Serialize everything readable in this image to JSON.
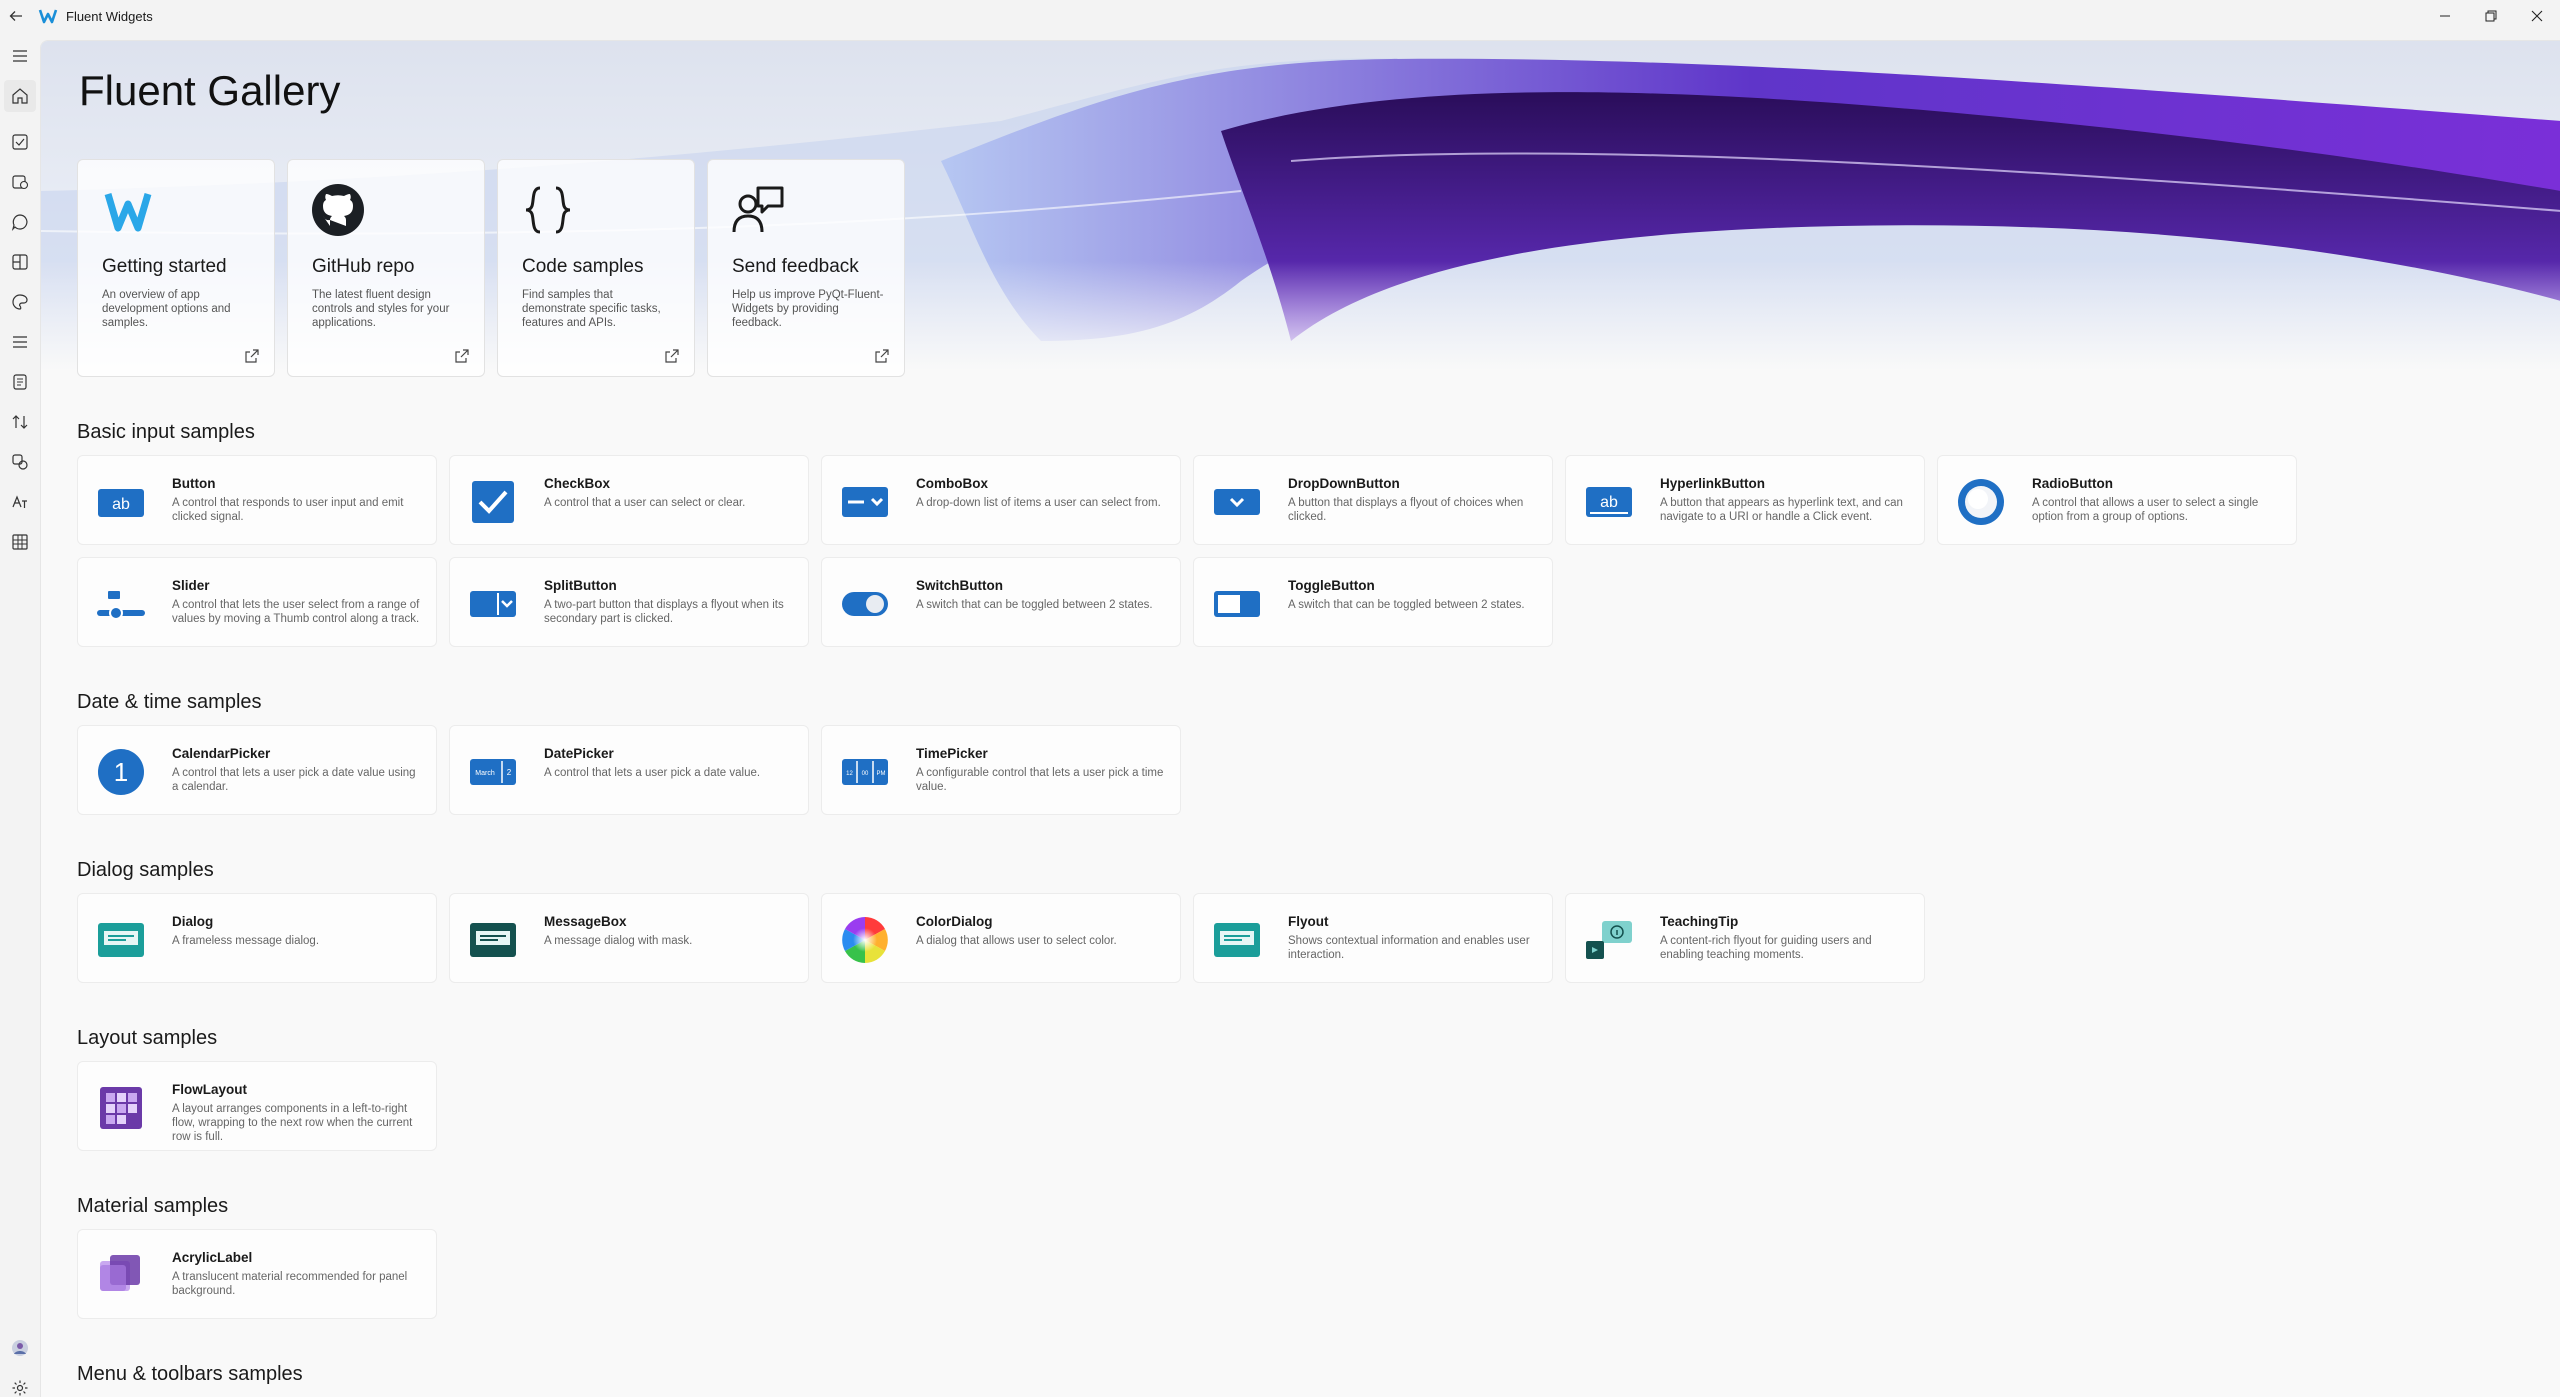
{
  "window": {
    "title": "Fluent Widgets",
    "controls": [
      "minimize-icon",
      "restore-icon",
      "close-icon"
    ]
  },
  "sidebar": {
    "items": [
      "menu-icon",
      "home-icon",
      "checkbox-icon",
      "datetime-icon",
      "chat-icon",
      "layout-icon",
      "palette-icon",
      "menu-list-icon",
      "document-icon",
      "transfer-icon",
      "status-icon",
      "text-icon",
      "table-icon",
      "avatar",
      "settings-icon"
    ]
  },
  "hero": {
    "title": "Fluent Gallery",
    "links": [
      {
        "title": "Getting started",
        "desc": "An overview of app development options and samples.",
        "icon": "fluent-logo-icon"
      },
      {
        "title": "GitHub repo",
        "desc": "The latest fluent design controls and styles for your applications.",
        "icon": "github-icon"
      },
      {
        "title": "Code samples",
        "desc": "Find samples that demonstrate specific tasks, features and APIs.",
        "icon": "code-braces-icon"
      },
      {
        "title": "Send feedback",
        "desc": "Help us improve PyQt-Fluent-Widgets by providing feedback.",
        "icon": "feedback-icon"
      }
    ]
  },
  "sections": {
    "basic": {
      "title": "Basic input samples",
      "cards": [
        {
          "title": "Button",
          "desc": "A control that responds to user input and emit clicked signal."
        },
        {
          "title": "CheckBox",
          "desc": "A control that a user can select or clear."
        },
        {
          "title": "ComboBox",
          "desc": "A drop-down list of items a user can select from."
        },
        {
          "title": "DropDownButton",
          "desc": "A button that displays a flyout of choices when clicked."
        },
        {
          "title": "HyperlinkButton",
          "desc": "A button that appears as hyperlink text, and can navigate to a URI or handle a Click event."
        },
        {
          "title": "RadioButton",
          "desc": "A control that allows a user to select a single option from a group of options."
        },
        {
          "title": "Slider",
          "desc": "A control that lets the user select from a range of values by moving a Thumb control along a track."
        },
        {
          "title": "SplitButton",
          "desc": "A two-part button that displays a flyout when its secondary part is clicked."
        },
        {
          "title": "SwitchButton",
          "desc": "A switch that can be toggled between 2 states."
        },
        {
          "title": "ToggleButton",
          "desc": "A switch that can be toggled between 2 states."
        }
      ]
    },
    "datetime": {
      "title": "Date & time samples",
      "cards": [
        {
          "title": "CalendarPicker",
          "desc": "A control that lets a user pick a date value using a calendar."
        },
        {
          "title": "DatePicker",
          "desc": "A control that lets a user pick a date value."
        },
        {
          "title": "TimePicker",
          "desc": "A configurable control that lets a user pick a time value."
        }
      ]
    },
    "dialog": {
      "title": "Dialog samples",
      "cards": [
        {
          "title": "Dialog",
          "desc": "A frameless message dialog."
        },
        {
          "title": "MessageBox",
          "desc": "A message dialog with mask."
        },
        {
          "title": "ColorDialog",
          "desc": "A dialog that allows user to select color."
        },
        {
          "title": "Flyout",
          "desc": "Shows contextual information and enables user interaction."
        },
        {
          "title": "TeachingTip",
          "desc": "A content-rich flyout for guiding users and enabling teaching moments."
        }
      ]
    },
    "layout": {
      "title": "Layout samples",
      "cards": [
        {
          "title": "FlowLayout",
          "desc": "A layout arranges components in a left-to-right flow, wrapping to the next row when the current row is full."
        }
      ]
    },
    "material": {
      "title": "Material samples",
      "cards": [
        {
          "title": "AcrylicLabel",
          "desc": "A translucent material recommended for panel background."
        }
      ]
    },
    "menu": {
      "title": "Menu & toolbars samples"
    }
  }
}
